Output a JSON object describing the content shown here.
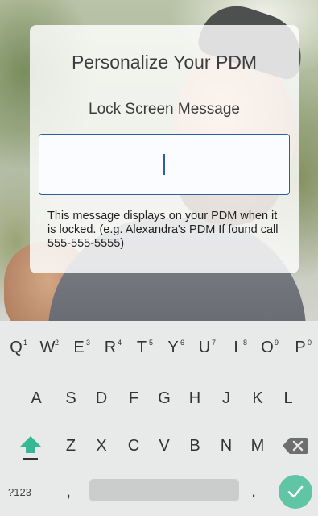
{
  "dialog": {
    "title": "Personalize Your PDM",
    "subtitle": "Lock Screen Message",
    "input": {
      "value": "",
      "placeholder": ""
    },
    "helper_text": "This message displays on your PDM when it is locked. (e.g. Alexandra's PDM If found call 555-555-5555)"
  },
  "keyboard": {
    "row1": [
      {
        "label": "Q",
        "hint": "1"
      },
      {
        "label": "W",
        "hint": "2"
      },
      {
        "label": "E",
        "hint": "3"
      },
      {
        "label": "R",
        "hint": "4"
      },
      {
        "label": "T",
        "hint": "5"
      },
      {
        "label": "Y",
        "hint": "6"
      },
      {
        "label": "U",
        "hint": "7"
      },
      {
        "label": "I",
        "hint": "8"
      },
      {
        "label": "O",
        "hint": "9"
      },
      {
        "label": "P",
        "hint": "0"
      }
    ],
    "row2": [
      "A",
      "S",
      "D",
      "F",
      "G",
      "H",
      "J",
      "K",
      "L"
    ],
    "row3": [
      "Z",
      "X",
      "C",
      "V",
      "B",
      "N",
      "M"
    ],
    "symbols_label": "?123",
    "comma": ",",
    "period": ".",
    "icons": {
      "shift": "shift-icon",
      "backspace": "backspace-icon",
      "enter": "checkmark-icon"
    },
    "accent_color": "#5fc5a4"
  }
}
